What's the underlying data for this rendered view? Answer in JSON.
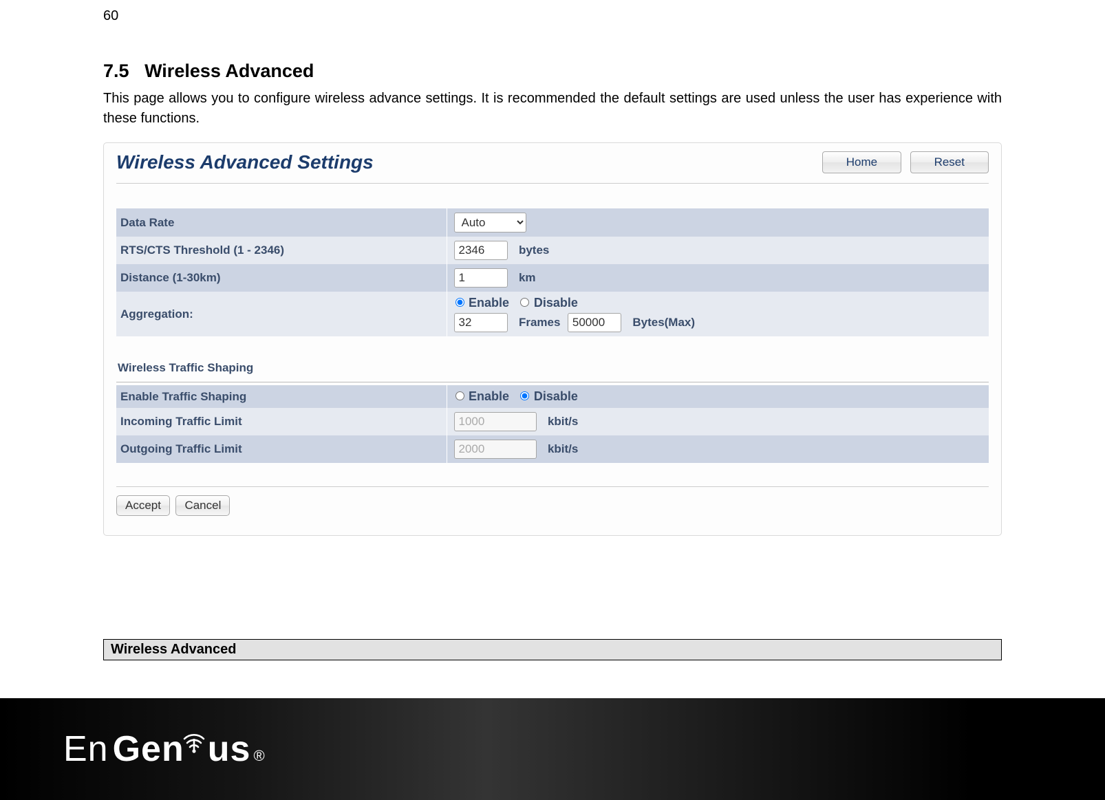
{
  "page_number": "60",
  "section": {
    "number": "7.5",
    "title": "Wireless Advanced",
    "description": "This page allows you to configure wireless advance settings. It is recommended the default settings are used unless the user has experience with these functions."
  },
  "panel": {
    "title": "Wireless Advanced Settings",
    "buttons": {
      "home": "Home",
      "reset": "Reset"
    }
  },
  "fields": {
    "data_rate": {
      "label": "Data Rate",
      "value": "Auto",
      "options": [
        "Auto"
      ]
    },
    "rts_cts": {
      "label": "RTS/CTS Threshold (1 - 2346)",
      "value": "2346",
      "unit": "bytes"
    },
    "distance": {
      "label": "Distance (1-30km)",
      "value": "1",
      "unit": "km"
    },
    "aggregation": {
      "label": "Aggregation:",
      "enable": "Enable",
      "disable": "Disable",
      "enabled": true,
      "frames_value": "32",
      "frames_unit": "Frames",
      "bytes_value": "50000",
      "bytes_unit": "Bytes(Max)"
    }
  },
  "shaping": {
    "header": "Wireless Traffic Shaping",
    "enable_label": "Enable Traffic Shaping",
    "enable": "Enable",
    "disable": "Disable",
    "enabled": false,
    "incoming": {
      "label": "Incoming Traffic Limit",
      "value": "1000",
      "unit": "kbit/s"
    },
    "outgoing": {
      "label": "Outgoing Traffic Limit",
      "value": "2000",
      "unit": "kbit/s"
    }
  },
  "actions": {
    "accept": "Accept",
    "cancel": "Cancel"
  },
  "table_header": "Wireless Advanced",
  "logo": {
    "part1": "En",
    "part2": "Gen",
    "part3": "us",
    "reg": "®"
  }
}
